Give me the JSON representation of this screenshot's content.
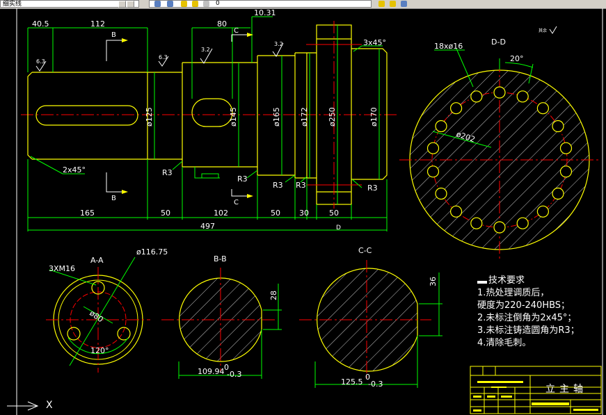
{
  "toolbar": {
    "layer_value": "细实线",
    "layer_value2": "0"
  },
  "views": {
    "main_dimensions_top": [
      "40.5",
      "112",
      "80",
      "10.31"
    ],
    "chamfer_top": "3x45°",
    "roughness": [
      "6.3",
      "6.3",
      "3.2",
      "3.2"
    ],
    "roughness_other": "其余",
    "section_marks": [
      "B",
      "B",
      "C",
      "C",
      "D"
    ],
    "diameters": [
      "ø125",
      "ø145",
      "ø165",
      "ø172",
      "ø250",
      "ø170"
    ],
    "radii": [
      "R3",
      "R3",
      "R3",
      "R3",
      "R3"
    ],
    "chamfer_bottom": "2x45°",
    "bottom_dims": [
      "165",
      "50",
      "102",
      "50",
      "30",
      "50"
    ],
    "total_length": "497",
    "dd_title": "D-D",
    "dd_holes": "18xø16",
    "dd_angle": "20°",
    "dd_pcd": "ø202",
    "aa_title": "A-A",
    "aa_thread": "3XM16",
    "aa_diameter": "ø116.75",
    "aa_pcd": "ø80",
    "aa_angle": "120°",
    "bb_title": "B-B",
    "bb_dim": "109.94",
    "bb_tol": "0",
    "bb_tol2": "-0.3",
    "bb_key": "28",
    "cc_title": "C-C",
    "cc_dim": "125.5",
    "cc_tol": "0",
    "cc_tol2": "-0.3",
    "cc_key": "36"
  },
  "notes": {
    "title": "技术要求",
    "items": [
      "1.热处理调质后，",
      "  硬度为220-240HBS；",
      "2.未标注倒角为2x45°；",
      "3.未标注铸造圆角为R3；",
      "4.清除毛刺。"
    ]
  },
  "title_block": {
    "part_name": "立主轴"
  },
  "ucs": {
    "axis_label": "X"
  }
}
